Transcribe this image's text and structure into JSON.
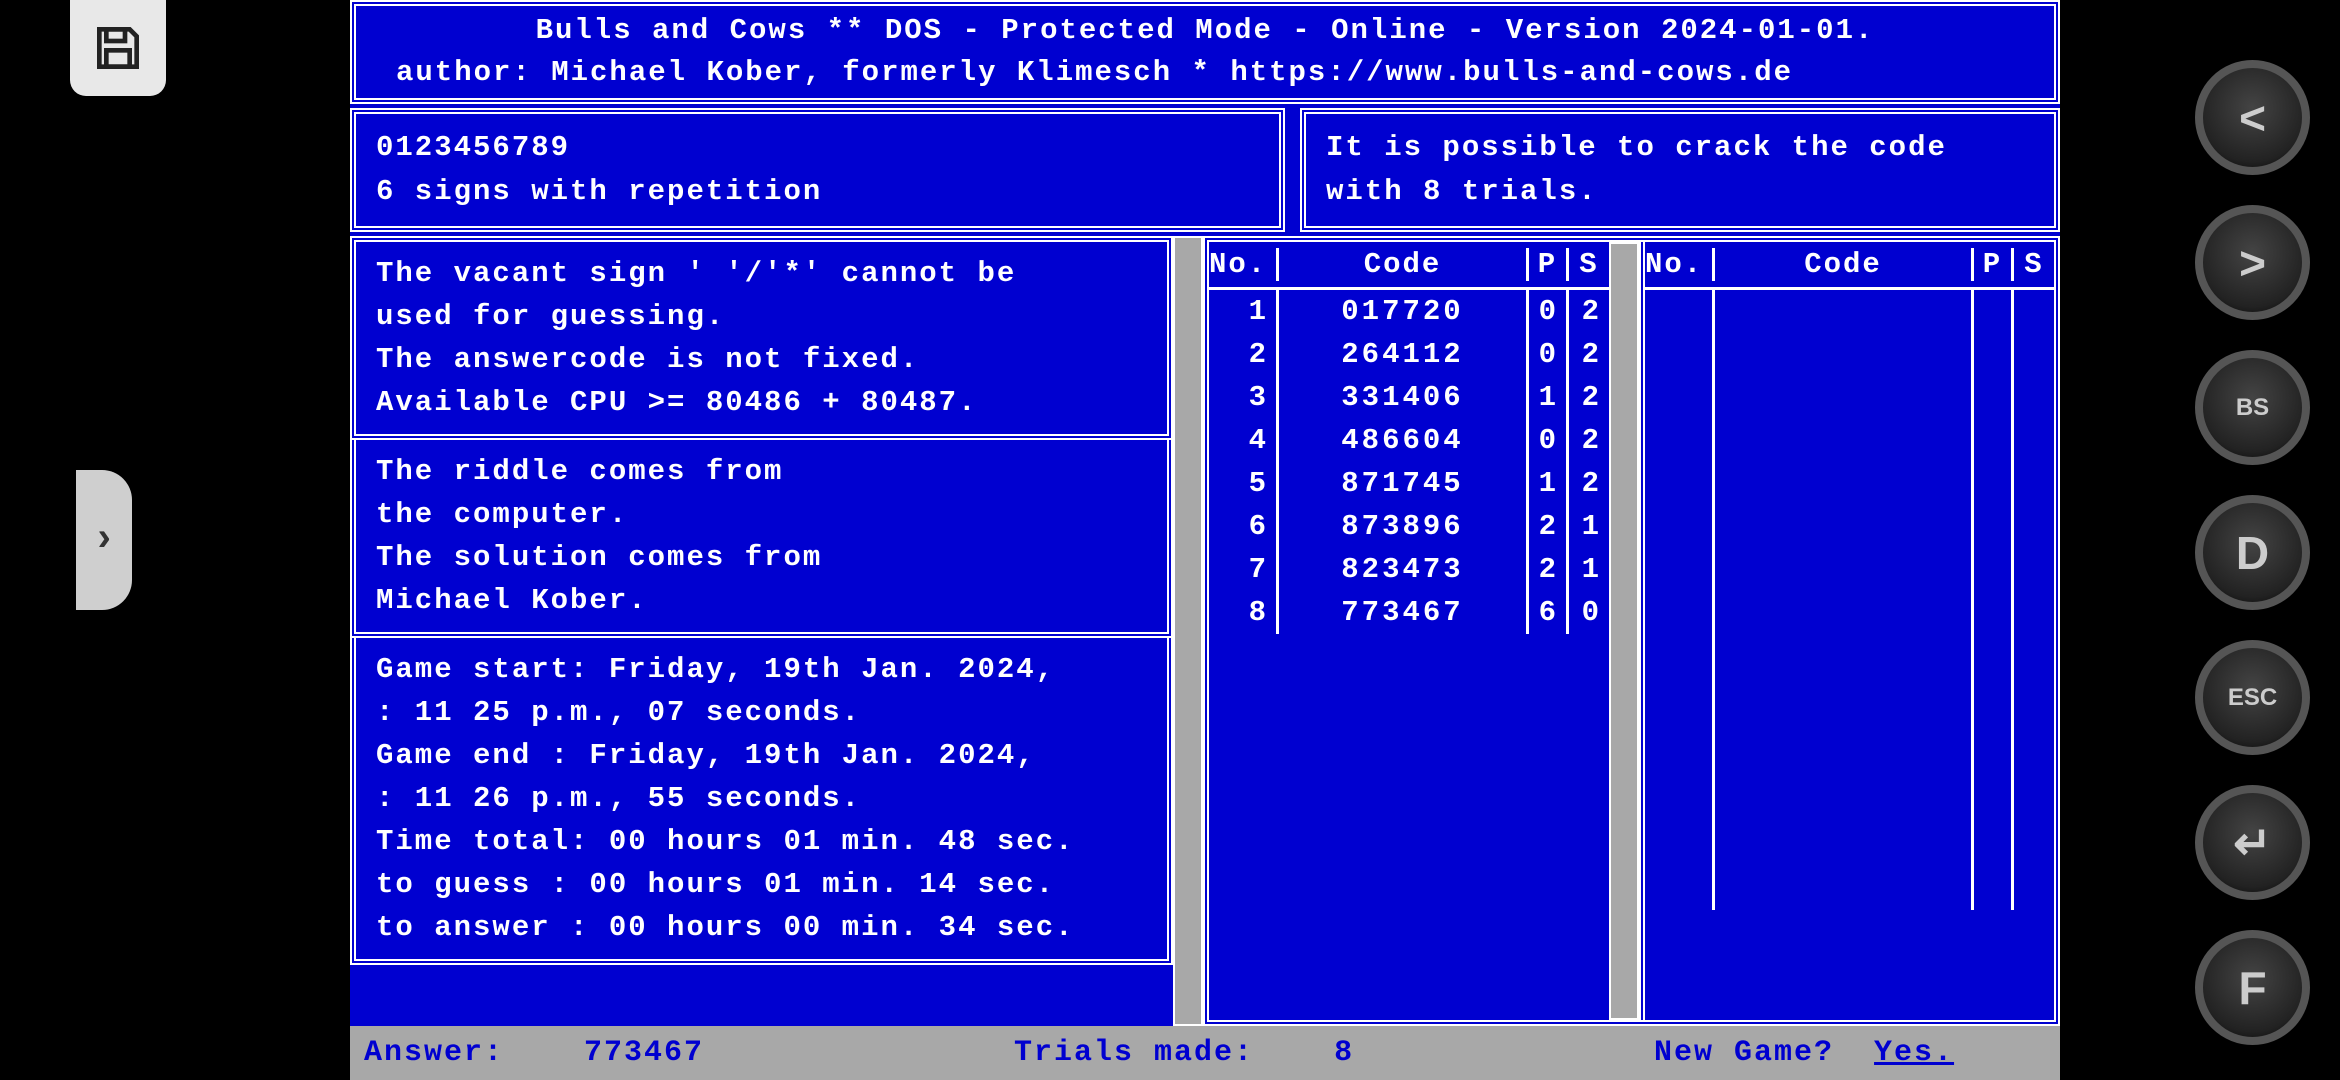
{
  "title": {
    "line1": "Bulls and Cows ** DOS - Protected Mode - Online - Version 2024-01-01.",
    "line2": "author: Michael Kober, formerly Klimesch * https://www.bulls-and-cows.de"
  },
  "digits_box": {
    "digits": "0123456789",
    "mode": "6 signs with repetition"
  },
  "hint_box": {
    "line1": "It is possible to crack the code",
    "line2": "with 8 trials."
  },
  "info1": "The vacant sign ' '/'*' cannot be\nused for guessing.\nThe answercode is not fixed.\nAvailable CPU >= 80486 + 80487.",
  "info2": "The riddle comes from\nthe computer.\nThe solution comes from\nMichael Kober.",
  "info3": "Game start: Friday, 19th Jan. 2024,\n          : 11 25 p.m., 07 seconds.\nGame end  : Friday, 19th Jan. 2024,\n          : 11 26 p.m., 55 seconds.\nTime total: 00 hours 01 min. 48 sec.\nto guess  : 00 hours 01 min. 14 sec.\nto answer : 00 hours 00 min. 34 sec.",
  "table": {
    "headers": {
      "no": "No.",
      "code": "Code",
      "p": "P",
      "s": "S"
    },
    "rows": [
      {
        "no": "1",
        "code": "017720",
        "p": "0",
        "s": "2"
      },
      {
        "no": "2",
        "code": "264112",
        "p": "0",
        "s": "2"
      },
      {
        "no": "3",
        "code": "331406",
        "p": "1",
        "s": "2"
      },
      {
        "no": "4",
        "code": "486604",
        "p": "0",
        "s": "2"
      },
      {
        "no": "5",
        "code": "871745",
        "p": "1",
        "s": "2"
      },
      {
        "no": "6",
        "code": "873896",
        "p": "2",
        "s": "1"
      },
      {
        "no": "7",
        "code": "823473",
        "p": "2",
        "s": "1"
      },
      {
        "no": "8",
        "code": "773467",
        "p": "6",
        "s": "0"
      }
    ]
  },
  "status": {
    "answer_label": "Answer:",
    "answer_value": "773467",
    "trials_label": "Trials made:",
    "trials_value": "8",
    "newgame_label": "New Game?",
    "newgame_value": "Yes."
  },
  "buttons": {
    "expand": "›",
    "lt": "<",
    "gt": ">",
    "bs": "BS",
    "d": "D",
    "esc": "ESC",
    "enter": "↵",
    "f": "F"
  }
}
